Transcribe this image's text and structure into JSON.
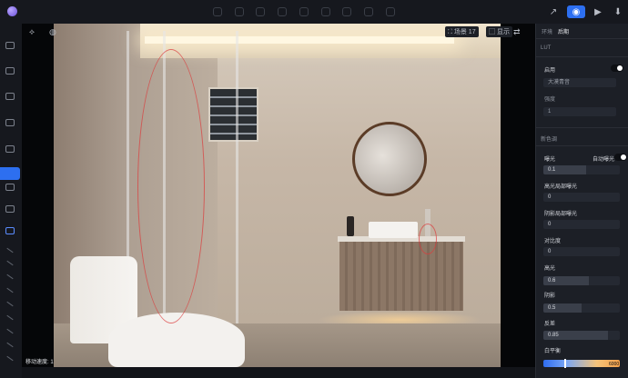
{
  "app": {
    "topbar_icons": [
      "drop-icon",
      "pen-icon",
      "brush-icon",
      "rotate-icon",
      "square-icon",
      "cut-icon",
      "dimension-icon",
      "flag-icon",
      "grid-icon"
    ],
    "topbar_right": [
      "share-icon",
      "camera-icon",
      "video-icon",
      "download-icon"
    ]
  },
  "viewport": {
    "scene_label": "场景 17",
    "display_label": "显示",
    "speed_label": "移动速度: 1"
  },
  "panel": {
    "tabs": [
      "环境",
      "后期"
    ],
    "active_tab": "后期",
    "lut_title": "LUT",
    "lut_enable": "启用",
    "lut_select": "大漠青音",
    "intensity_label": "强度",
    "intensity_value": "1",
    "new_section": "新色调",
    "exposure_label": "曝光",
    "auto_exposure": "自动曝光",
    "exposure_value": "0.1",
    "highlight_detail_label": "高光局部曝光",
    "highlight_detail_value": "0",
    "shadow_detail_label": "阴影局部曝光",
    "shadow_detail_value": "0",
    "contrast_label": "对比度",
    "contrast_value": "0",
    "highlight_label": "高光",
    "highlight_value": "0.6",
    "shadow_label": "阴影",
    "shadow_value": "0.5",
    "reflection_label": "反差",
    "reflection_value": "0.85",
    "white_balance_label": "白平衡",
    "white_balance_value": "6000"
  },
  "colors": {
    "accent": "#2d6ff0",
    "panel_bg": "#1c1f26",
    "app_bg": "#121419"
  }
}
